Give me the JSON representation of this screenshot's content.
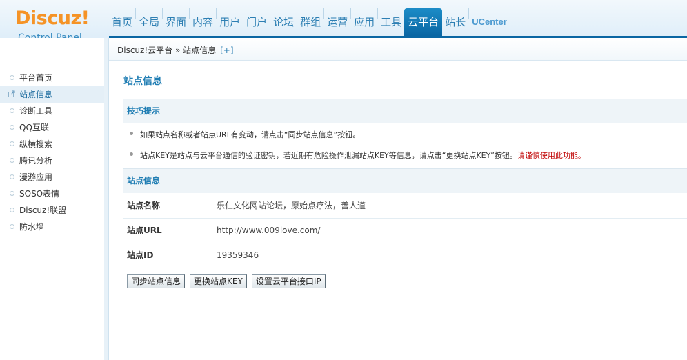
{
  "logo": {
    "brand": "Discuz!",
    "sub": "Control Panel"
  },
  "nav": [
    {
      "label": "首页"
    },
    {
      "label": "全局"
    },
    {
      "label": "界面"
    },
    {
      "label": "内容"
    },
    {
      "label": "用户"
    },
    {
      "label": "门户"
    },
    {
      "label": "论坛"
    },
    {
      "label": "群组"
    },
    {
      "label": "运营"
    },
    {
      "label": "应用"
    },
    {
      "label": "工具"
    },
    {
      "label": "云平台",
      "active": true
    },
    {
      "label": "站长"
    },
    {
      "label": "UCenter"
    }
  ],
  "breadcrumb": {
    "text": "Discuz!云平台 » 站点信息",
    "add": "[+]"
  },
  "sidebar": {
    "items": [
      {
        "label": "平台首页"
      },
      {
        "label": "站点信息",
        "active": true
      },
      {
        "label": "诊断工具"
      },
      {
        "label": "QQ互联"
      },
      {
        "label": "纵横搜索"
      },
      {
        "label": "腾讯分析"
      },
      {
        "label": "漫游应用"
      },
      {
        "label": "SOSO表情"
      },
      {
        "label": "Discuz!联盟"
      },
      {
        "label": "防水墙"
      }
    ]
  },
  "main": {
    "title": "站点信息",
    "tips_header": "技巧提示",
    "tips": [
      {
        "text": "如果站点名称或者站点URL有变动，请点击“同步站点信息”按钮。"
      },
      {
        "text": "站点KEY是站点与云平台通信的验证密钥，若近期有危险操作泄漏站点KEY等信息，请点击“更换站点KEY”按钮。",
        "warn": "请谨慎使用此功能。"
      }
    ],
    "info_header": "站点信息",
    "fields": [
      {
        "key": "站点名称",
        "value": "乐仁文化网站论坛，原始点疗法，善人道"
      },
      {
        "key": "站点URL",
        "value": "http://www.009love.com/"
      },
      {
        "key": "站点ID",
        "value": "19359346"
      }
    ],
    "buttons": {
      "sync": "同步站点信息",
      "change_key": "更换站点KEY",
      "set_ip": "设置云平台接口IP"
    }
  },
  "colors": {
    "accent": "#1f7db3",
    "nav_active": "#0a66a3",
    "logo": "#f59326",
    "warn": "#c00000"
  }
}
